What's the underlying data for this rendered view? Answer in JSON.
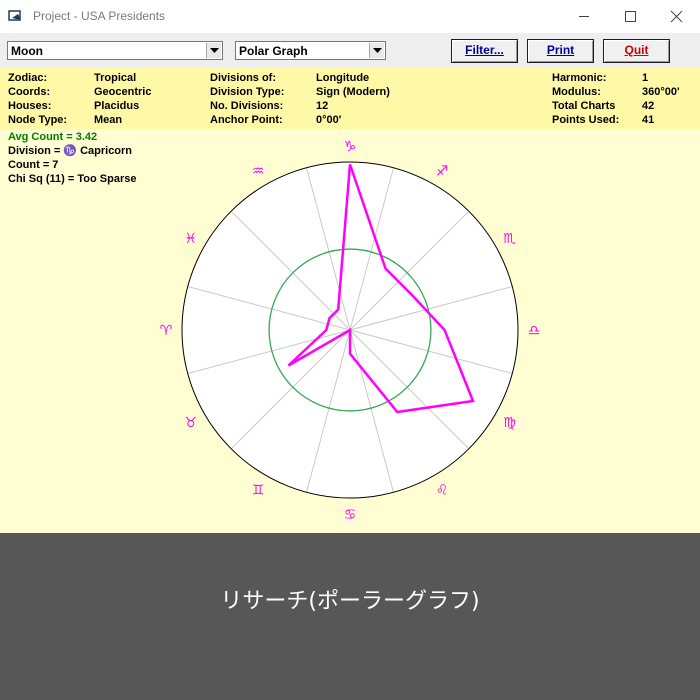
{
  "window": {
    "title": "Project - USA Presidents",
    "bg_color": "#fffdd2"
  },
  "toolbar": {
    "object_select": "Moon",
    "graph_select": "Polar Graph",
    "filter_label": "Filter...",
    "print_label": "Print",
    "quit_label": "Quit"
  },
  "info": {
    "zodiac_label": "Zodiac:",
    "zodiac_value": "Tropical",
    "coords_label": "Coords:",
    "coords_value": "Geocentric",
    "houses_label": "Houses:",
    "houses_value": "Placidus",
    "node_type_label": "Node Type:",
    "node_type_value": "Mean",
    "divisions_of_label": "Divisions of:",
    "divisions_of_value": "Longitude",
    "division_type_label": "Division Type:",
    "division_type_value": "Sign (Modern)",
    "no_divisions_label": "No. Divisions:",
    "no_divisions_value": "12",
    "anchor_point_label": "Anchor Point:",
    "anchor_point_value": "0°00'",
    "harmonic_label": "Harmonic:",
    "harmonic_value": "1",
    "modulus_label": "Modulus:",
    "modulus_value": "360°00'",
    "total_charts_label": "Total Charts",
    "total_charts_value": "42",
    "points_used_label": "Points Used:",
    "points_used_value": "41"
  },
  "stats": {
    "avg_count": "Avg Count = 3.42",
    "division": "Division = ♑ Capricorn",
    "count": "Count = 7",
    "chi_sq": "Chi Sq (11) = Too Sparse"
  },
  "chart_data": {
    "type": "polar",
    "signs": [
      "♈",
      "♉",
      "♊",
      "♋",
      "♌",
      "♍",
      "♎",
      "♏",
      "♐",
      "♑",
      "♒",
      "♓"
    ],
    "sign_names": [
      "Aries",
      "Taurus",
      "Gemini",
      "Cancer",
      "Leo",
      "Virgo",
      "Libra",
      "Scorpio",
      "Sagittarius",
      "Capricorn",
      "Aquarius",
      "Pisces"
    ],
    "values": [
      1,
      3,
      0,
      1,
      4,
      6,
      4,
      3,
      3,
      7,
      1,
      1
    ],
    "average": 3.42,
    "max_scale": 7.1,
    "colors": {
      "data_line": "#ff00ff",
      "average_circle": "#33aa55",
      "glyphs": "#ff00ff",
      "spokes": "#c9c9c9",
      "outer_circle": "#000000",
      "plot_bg": "#ffffff"
    }
  },
  "caption": "リサーチ(ポーラーグラフ)"
}
